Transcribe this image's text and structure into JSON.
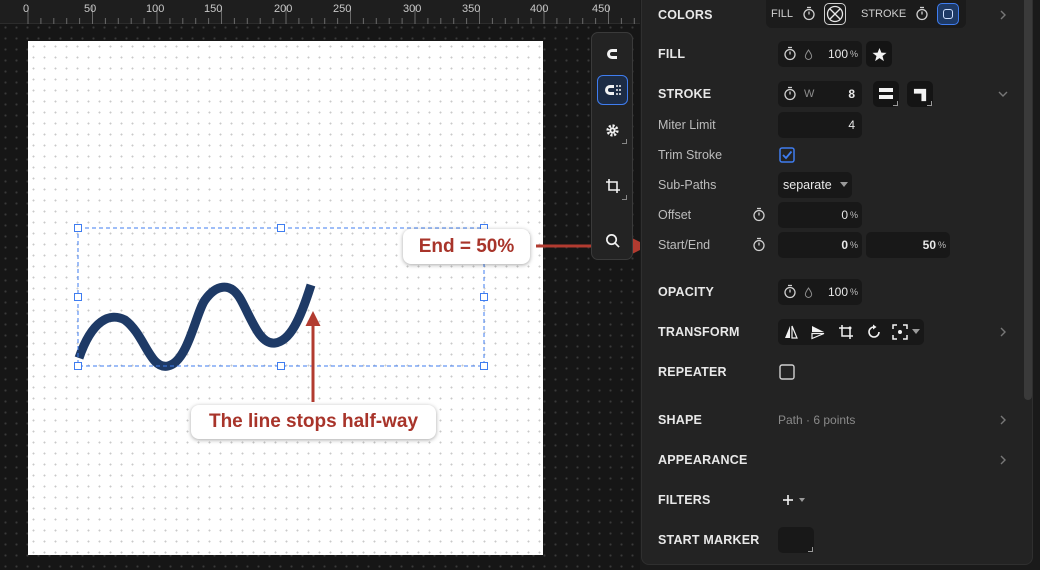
{
  "ruler": {
    "ticks": [
      "0",
      "50",
      "100",
      "150",
      "200",
      "250",
      "300",
      "350",
      "400",
      "450"
    ]
  },
  "callouts": {
    "end": "End = 50%",
    "half": "The line stops half-way"
  },
  "colors": {
    "accent": "#3f7df0",
    "path_stroke": "#1e3a66",
    "callout_red": "#a8342a",
    "selection": "#3f7df0"
  },
  "panel": {
    "colors": {
      "label": "COLORS",
      "fill_label": "FILL",
      "stroke_label": "STROKE"
    },
    "fill": {
      "label": "FILL",
      "value": "100",
      "unit": "%"
    },
    "stroke": {
      "label": "STROKE",
      "w_label": "W",
      "value": "8"
    },
    "miter": {
      "label": "Miter Limit",
      "value": "4"
    },
    "trim": {
      "label": "Trim Stroke",
      "checked": true
    },
    "subpaths": {
      "label": "Sub-Paths",
      "value": "separate"
    },
    "offset": {
      "label": "Offset",
      "value": "0",
      "unit": "%"
    },
    "start_end": {
      "label": "Start/End",
      "start": "0",
      "end": "50",
      "unit": "%"
    },
    "opacity": {
      "label": "OPACITY",
      "value": "100",
      "unit": "%"
    },
    "transform": {
      "label": "TRANSFORM"
    },
    "repeater": {
      "label": "REPEATER",
      "checked": false
    },
    "shape": {
      "label": "SHAPE",
      "info": "Path · 6 points"
    },
    "appearance": {
      "label": "APPEARANCE"
    },
    "filters": {
      "label": "FILTERS"
    },
    "start_marker": {
      "label": "START MARKER"
    }
  }
}
